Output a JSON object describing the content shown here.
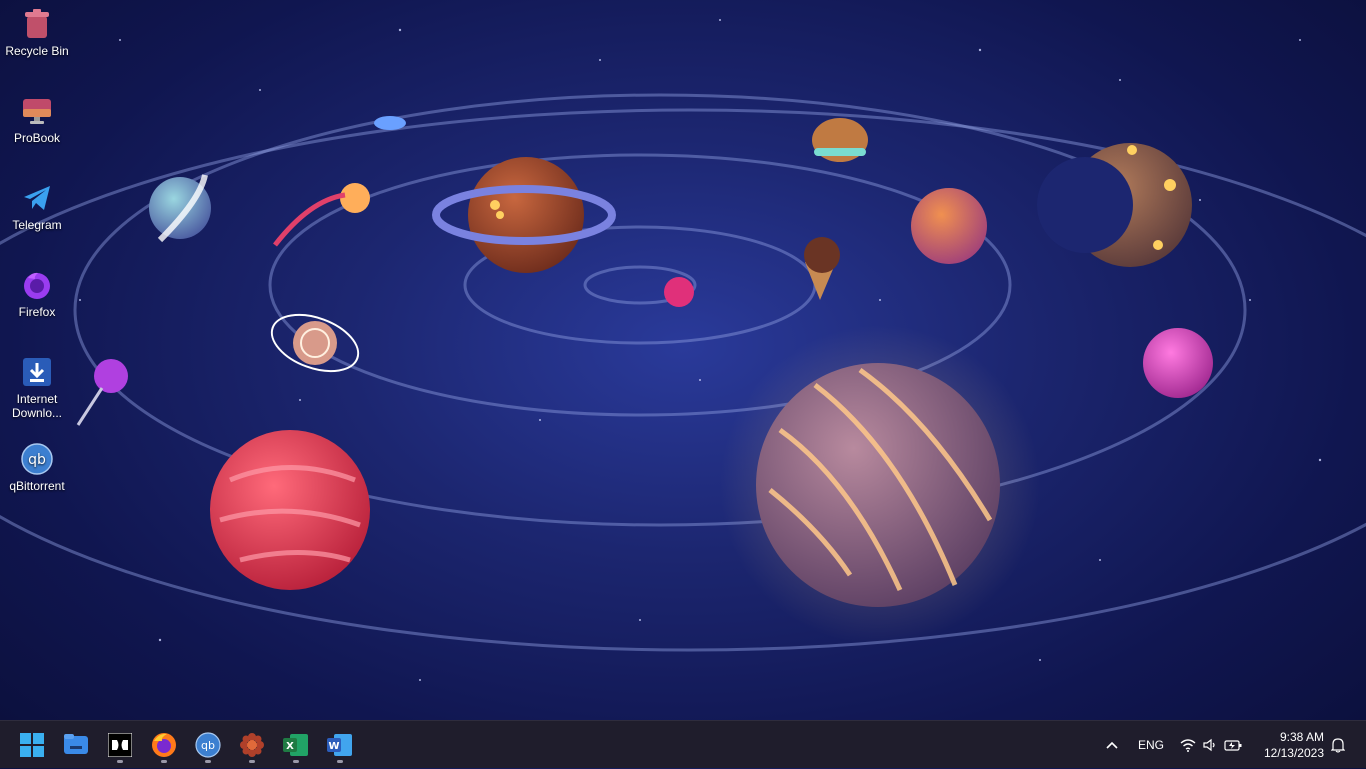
{
  "desktop_icons": [
    {
      "label": "Recycle Bin",
      "icon": "recycle-bin-icon"
    },
    {
      "label": "ProBook",
      "icon": "monitor-icon"
    },
    {
      "label": "Telegram",
      "icon": "telegram-icon"
    },
    {
      "label": "Firefox",
      "icon": "firefox-icon"
    },
    {
      "label": "Internet Downlo...",
      "icon": "download-icon"
    },
    {
      "label": "qBittorrent",
      "icon": "qbittorrent-icon"
    }
  ],
  "taskbar": {
    "apps": [
      {
        "name": "start",
        "icon": "windows-start-icon",
        "running": false
      },
      {
        "name": "file-explorer",
        "icon": "folder-icon",
        "running": false
      },
      {
        "name": "dolby",
        "icon": "dolby-icon",
        "running": true
      },
      {
        "name": "firefox",
        "icon": "firefox-icon",
        "running": true
      },
      {
        "name": "qbittorrent",
        "icon": "qbittorrent-icon",
        "running": true
      },
      {
        "name": "settings-app",
        "icon": "flower-gear-icon",
        "running": true
      },
      {
        "name": "excel",
        "icon": "excel-icon",
        "running": true
      },
      {
        "name": "word",
        "icon": "word-icon",
        "running": true
      }
    ],
    "tray": {
      "language": "ENG",
      "time": "9:38 AM",
      "date": "12/13/2023"
    }
  },
  "colors": {
    "taskbar_bg": "#1f1d2c",
    "wallpaper_bg": "#1c2670",
    "excel_green": "#1f7a43",
    "word_blue": "#2b5dbb"
  }
}
